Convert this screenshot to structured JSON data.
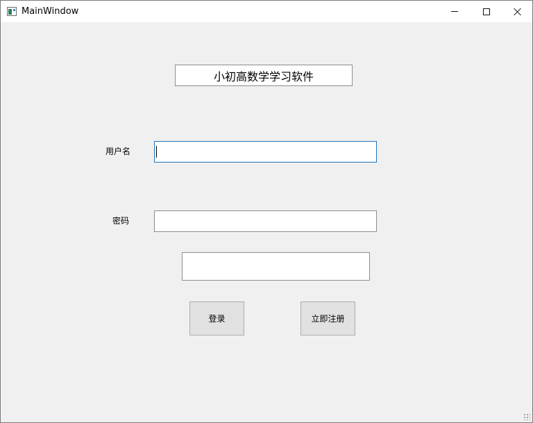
{
  "window": {
    "title": "MainWindow"
  },
  "app": {
    "heading": "小初高数学学习软件"
  },
  "form": {
    "username_label": "用户名",
    "username_value": "",
    "password_label": "密码",
    "password_value": "",
    "message": ""
  },
  "buttons": {
    "login": "登录",
    "register": "立即注册"
  },
  "icons": {
    "app": "app-window-icon",
    "minimize": "minimize-icon",
    "maximize": "maximize-icon",
    "close": "close-icon",
    "resize": "resize-grip-icon"
  }
}
